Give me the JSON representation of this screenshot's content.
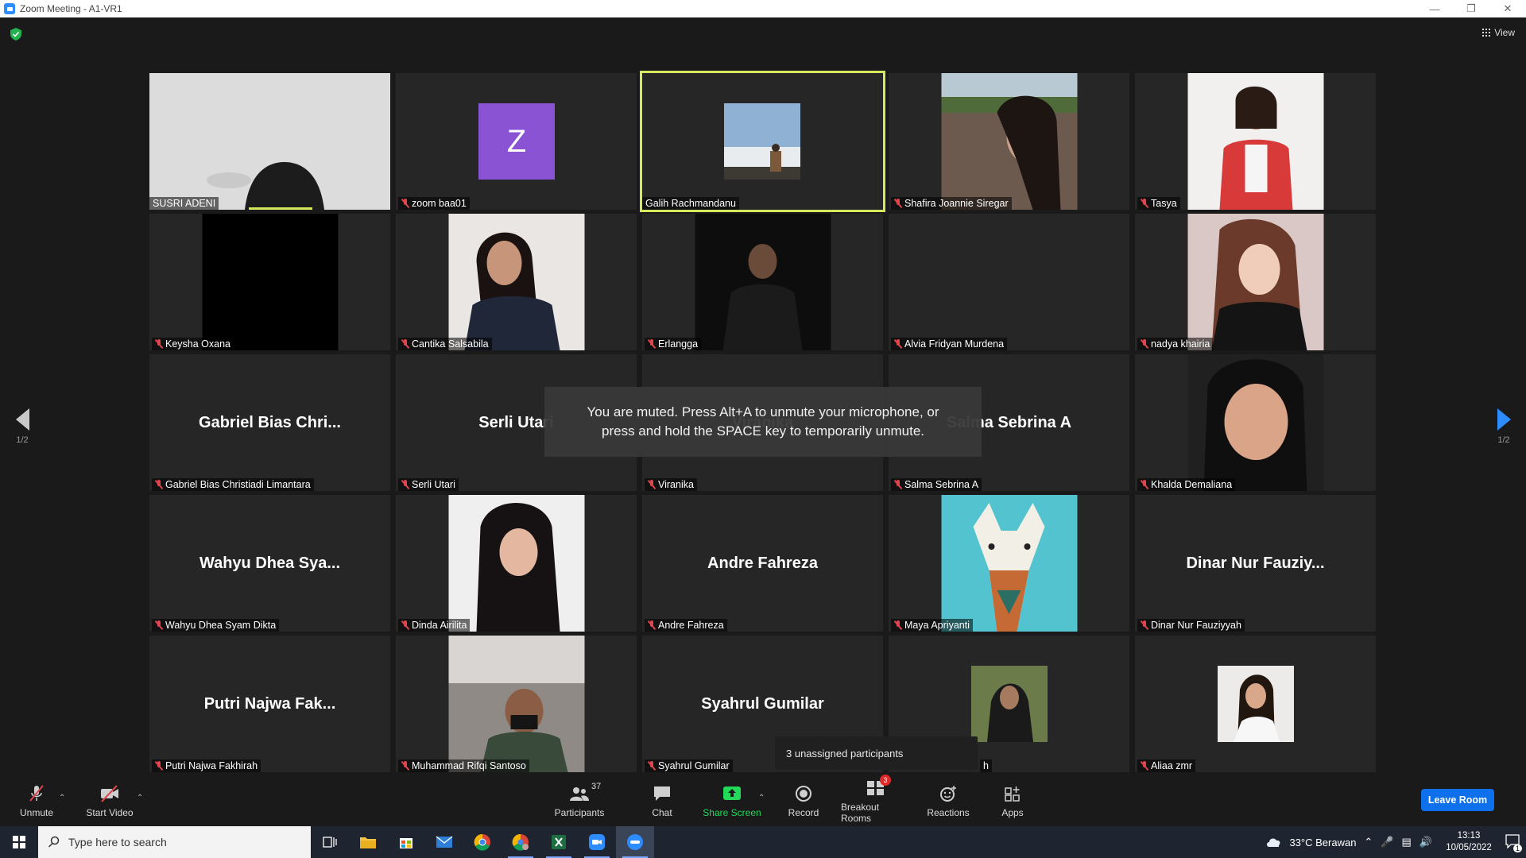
{
  "window": {
    "title": "Zoom Meeting - A1-VR1"
  },
  "view_label": "View",
  "pagination": {
    "left": "1/2",
    "right": "1/2"
  },
  "tiles": [
    {
      "name": "SUSRI ADENI",
      "muted": false,
      "type": "video"
    },
    {
      "name": "zoom baa01",
      "muted": true,
      "type": "avatar",
      "initial": "Z"
    },
    {
      "name": "Galih Rachmandanu",
      "muted": false,
      "type": "thumb"
    },
    {
      "name": "Shafira Joannie Siregar",
      "muted": true,
      "type": "photo"
    },
    {
      "name": "Tasya",
      "muted": true,
      "type": "photo"
    },
    {
      "name": "Keysha Oxana",
      "muted": true,
      "type": "photo"
    },
    {
      "name": "Cantika Salsabila",
      "muted": true,
      "type": "photo"
    },
    {
      "name": "Erlangga",
      "muted": true,
      "type": "photo"
    },
    {
      "name": "Alvia Fridyan Murdena",
      "muted": true,
      "type": "blank"
    },
    {
      "name": "nadya khairia",
      "muted": true,
      "type": "photo"
    },
    {
      "name": "Gabriel Bias Christiadi Limantara",
      "display": "Gabriel Bias Chri...",
      "muted": true,
      "type": "name"
    },
    {
      "name": "Serli Utari",
      "display": "Serli Utari",
      "muted": true,
      "type": "name"
    },
    {
      "name": "Viranika",
      "display": "Viranika",
      "muted": true,
      "type": "name"
    },
    {
      "name": "Salma Sebrina A",
      "display": "Salma Sebrina A",
      "muted": true,
      "type": "name"
    },
    {
      "name": "Khalda Demaliana",
      "muted": true,
      "type": "photo"
    },
    {
      "name": "Wahyu Dhea Syam Dikta",
      "display": "Wahyu Dhea Sya...",
      "muted": true,
      "type": "name"
    },
    {
      "name": "Dinda Airilita",
      "muted": true,
      "type": "photo"
    },
    {
      "name": "Andre Fahreza",
      "display": "Andre Fahreza",
      "muted": true,
      "type": "name"
    },
    {
      "name": "Maya Apriyanti",
      "muted": true,
      "type": "photo"
    },
    {
      "name": "Dinar Nur Fauziyyah",
      "display": "Dinar Nur Fauziy...",
      "muted": true,
      "type": "name"
    },
    {
      "name": "Putri Najwa Fakhirah",
      "display": "Putri Najwa Fak...",
      "muted": true,
      "type": "name"
    },
    {
      "name": "Muhammad Rifqi Santoso",
      "muted": true,
      "type": "photo"
    },
    {
      "name": "Syahrul Gumilar",
      "display": "Syahrul Gumilar",
      "muted": true,
      "type": "name"
    },
    {
      "name": "h",
      "muted": false,
      "type": "thumb"
    },
    {
      "name": "Aliaa zmr",
      "muted": true,
      "type": "thumb"
    }
  ],
  "toast": {
    "line1": "You are muted. Press Alt+A to unmute your microphone, or",
    "line2": "press and hold the SPACE key to temporarily unmute."
  },
  "unassigned": "3 unassigned participants",
  "toolbar": {
    "unmute": "Unmute",
    "start_video": "Start Video",
    "participants": "Participants",
    "participants_count": "37",
    "chat": "Chat",
    "share_screen": "Share Screen",
    "record": "Record",
    "breakout_rooms": "Breakout Rooms",
    "breakout_badge": "3",
    "reactions": "Reactions",
    "apps": "Apps",
    "leave_room": "Leave Room"
  },
  "taskbar": {
    "search_placeholder": "Type here to search",
    "weather": "33°C  Berawan",
    "time": "13:13",
    "date": "10/05/2022",
    "notifications": "1"
  },
  "colors": {
    "speaker_border": "#d6e85c",
    "share_green": "#23d959",
    "leave_blue": "#0e71eb",
    "muted_red": "#e0454e"
  }
}
